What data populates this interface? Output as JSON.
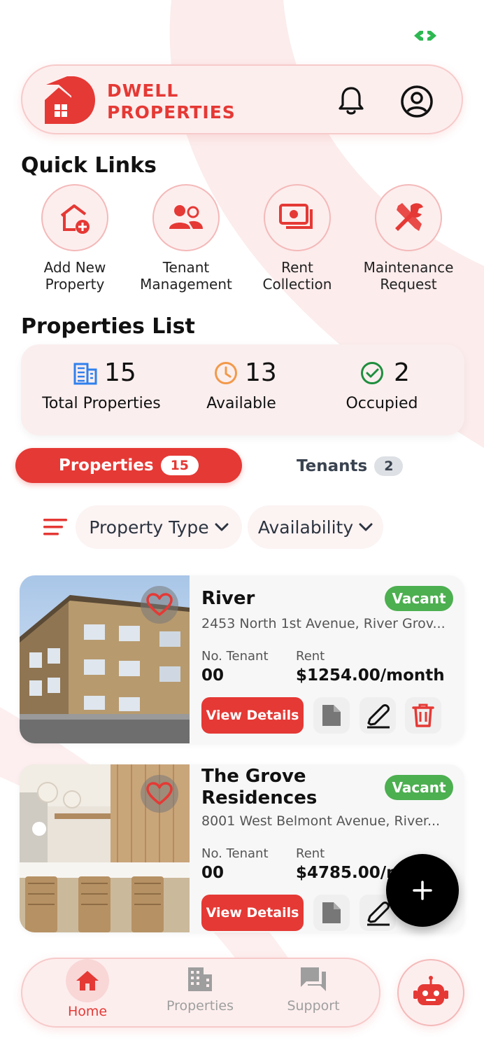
{
  "brand": {
    "line1": "DWELL",
    "line2": "PROPERTIES",
    "accent": "#e53935"
  },
  "header": {
    "icons": [
      "bell-icon",
      "user-account-icon"
    ]
  },
  "quick_links": {
    "title": "Quick Links",
    "items": [
      {
        "line1": "Add New",
        "line2": "Property",
        "icon": "add-home-icon"
      },
      {
        "line1": "Tenant",
        "line2": "Management",
        "icon": "people-icon"
      },
      {
        "line1": "Rent",
        "line2": "Collection",
        "icon": "payments-icon"
      },
      {
        "line1": "Maintenance",
        "line2": "Request",
        "icon": "tools-icon"
      }
    ]
  },
  "properties_list": {
    "title": "Properties List",
    "stats": [
      {
        "value": "15",
        "label": "Total Properties",
        "icon": "buildings-icon",
        "color": "#2f80ed"
      },
      {
        "value": "13",
        "label": "Available",
        "icon": "clock-icon",
        "color": "#f2994a"
      },
      {
        "value": "2",
        "label": "Occupied",
        "icon": "check-circle-icon",
        "color": "#1e8e3e"
      }
    ]
  },
  "tabs": [
    {
      "label": "Properties",
      "count": "15",
      "active": true
    },
    {
      "label": "Tenants",
      "count": "2",
      "active": false
    }
  ],
  "filters": [
    {
      "label": "Property Type"
    },
    {
      "label": "Availability"
    }
  ],
  "properties": [
    {
      "title_line1": "River",
      "title_line2": "",
      "status": "Vacant",
      "address": "2453 North 1st Avenue, River Grov...",
      "tenant_label": "No. Tenant",
      "tenant_value": "00",
      "rent_label": "Rent",
      "rent_value": "$1254.00/month",
      "view_label": "View Details"
    },
    {
      "title_line1": "The Grove",
      "title_line2": "Residences",
      "status": "Vacant",
      "address": "8001 West Belmont Avenue, River...",
      "tenant_label": "No. Tenant",
      "tenant_value": "00",
      "rent_label": "Rent",
      "rent_value": "$4785.00/month",
      "view_label": "View Details"
    }
  ],
  "bottom_nav": [
    {
      "label": "Home",
      "icon": "home-icon",
      "active": true
    },
    {
      "label": "Properties",
      "icon": "building-icon",
      "active": false
    },
    {
      "label": "Support",
      "icon": "chat-icon",
      "active": false
    }
  ],
  "colors": {
    "status_green": "#4caf50",
    "nav_inactive": "#9e9e9e"
  }
}
